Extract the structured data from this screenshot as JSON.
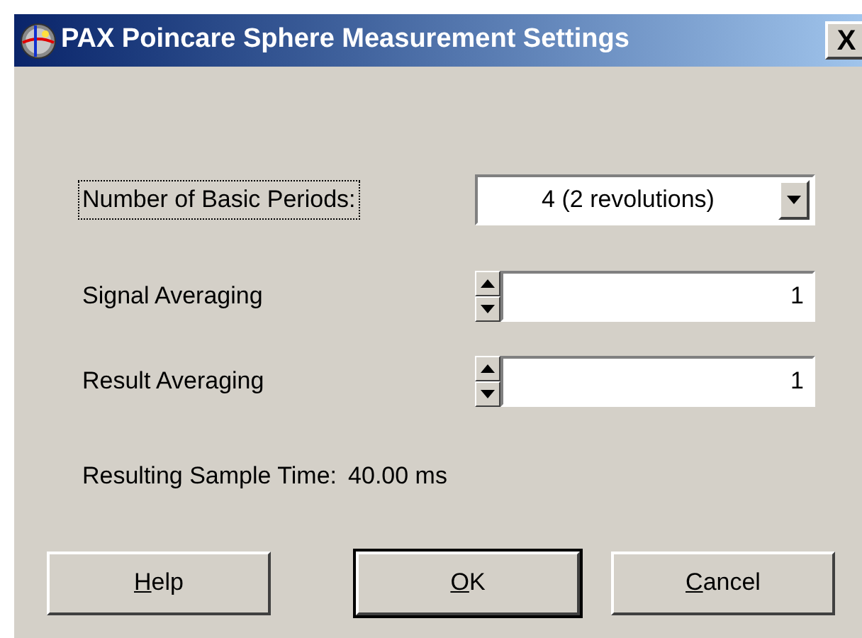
{
  "window": {
    "title": "PAX Poincare Sphere Measurement Settings",
    "close": "X"
  },
  "periods": {
    "label": "Number of Basic Periods:",
    "focused": true,
    "value": "4 (2 revolutions)"
  },
  "spinners": [
    {
      "label": "Signal Averaging",
      "value": "1"
    },
    {
      "label": "Result Averaging",
      "value": "1"
    }
  ],
  "sample_time": {
    "label": "Resulting Sample Time:",
    "value": "40.00 ms"
  },
  "buttons": [
    {
      "label": "Help",
      "default": false,
      "underline_first": true
    },
    {
      "label": "OK",
      "default": true,
      "underline_first": true
    },
    {
      "label": "Cancel",
      "default": false,
      "underline_first": true
    }
  ]
}
